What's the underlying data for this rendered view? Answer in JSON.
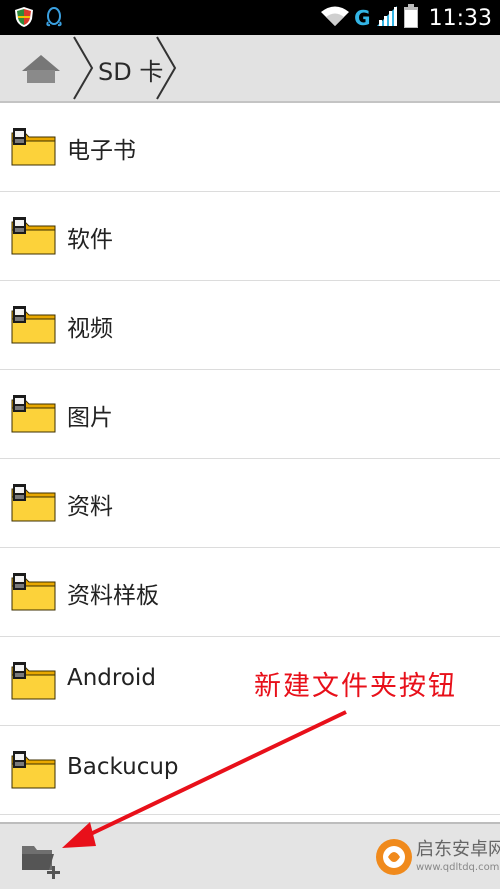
{
  "status_bar": {
    "time": "11:33",
    "network_type": "G",
    "icons": [
      "shield-icon",
      "qq-penguin-icon",
      "wifi-icon",
      "signal-icon",
      "battery-icon"
    ]
  },
  "breadcrumb": {
    "home_icon": "home-icon",
    "current": "SD 卡"
  },
  "folders": [
    {
      "label": "电子书"
    },
    {
      "label": "软件"
    },
    {
      "label": "视频"
    },
    {
      "label": "图片"
    },
    {
      "label": "资料"
    },
    {
      "label": "资料样板"
    },
    {
      "label": "Android"
    },
    {
      "label": "Backucup"
    }
  ],
  "bottom_bar": {
    "new_folder_icon": "new-folder-icon"
  },
  "annotation": {
    "text": "新建文件夹按钮",
    "color": "#e8101a"
  },
  "watermark": {
    "name": "启东安卓网",
    "url": "www.qdltdq.com"
  },
  "colors": {
    "folder": "#f5c518",
    "statusbar": "#000000",
    "toolbar": "#e2e2e2",
    "accent": "#33b5e5"
  }
}
